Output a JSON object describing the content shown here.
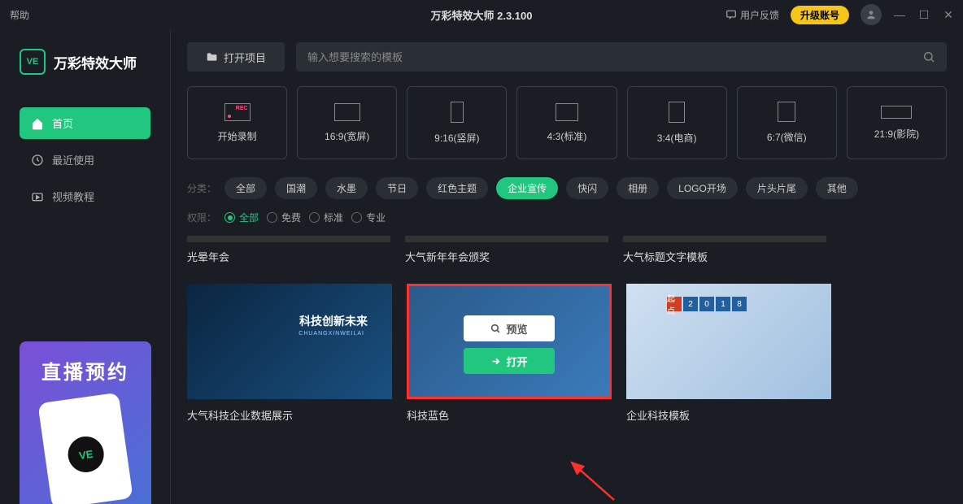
{
  "titlebar": {
    "help": "帮助",
    "title": "万彩特效大师 2.3.100",
    "feedback": "用户反馈",
    "upgrade": "升级账号"
  },
  "logo": {
    "badge": "VE",
    "text": "万彩特效大师"
  },
  "nav": [
    {
      "icon": "home",
      "label": "首页",
      "active": true
    },
    {
      "icon": "clock",
      "label": "最近使用",
      "active": false
    },
    {
      "icon": "video",
      "label": "视频教程",
      "active": false
    }
  ],
  "promo": {
    "title": "直播预约",
    "badge": "VE"
  },
  "open_project": "打开项目",
  "search": {
    "placeholder": "输入想要搜索的模板"
  },
  "tiles": [
    {
      "label": "开始录制"
    },
    {
      "label": "16:9(宽屏)"
    },
    {
      "label": "9:16(竖屏)"
    },
    {
      "label": "4:3(标准)"
    },
    {
      "label": "3:4(电商)"
    },
    {
      "label": "6:7(微信)"
    },
    {
      "label": "21:9(影院)"
    }
  ],
  "cat_label": "分类：",
  "categories": [
    {
      "label": "全部"
    },
    {
      "label": "国潮"
    },
    {
      "label": "水墨"
    },
    {
      "label": "节日"
    },
    {
      "label": "红色主题"
    },
    {
      "label": "企业宣传",
      "active": true
    },
    {
      "label": "快闪"
    },
    {
      "label": "相册"
    },
    {
      "label": "LOGO开场"
    },
    {
      "label": "片头片尾"
    },
    {
      "label": "其他"
    }
  ],
  "perm_label": "权限：",
  "perms": [
    {
      "label": "全部",
      "sel": true
    },
    {
      "label": "免费"
    },
    {
      "label": "标准"
    },
    {
      "label": "专业"
    }
  ],
  "row1": [
    {
      "title": "光晕年会"
    },
    {
      "title": "大气新年年会颁奖"
    },
    {
      "title": "大气标题文字模板"
    }
  ],
  "row2": [
    {
      "title": "大气科技企业数据展示",
      "inner": "科技创新未来",
      "sub": "CHUANGXINWEILAI"
    },
    {
      "title": "科技蓝色",
      "hover": true,
      "preview": "预览",
      "open": "打开"
    },
    {
      "title": "企业科技模板",
      "year": [
        "起点",
        "2",
        "0",
        "1",
        "8"
      ]
    }
  ]
}
